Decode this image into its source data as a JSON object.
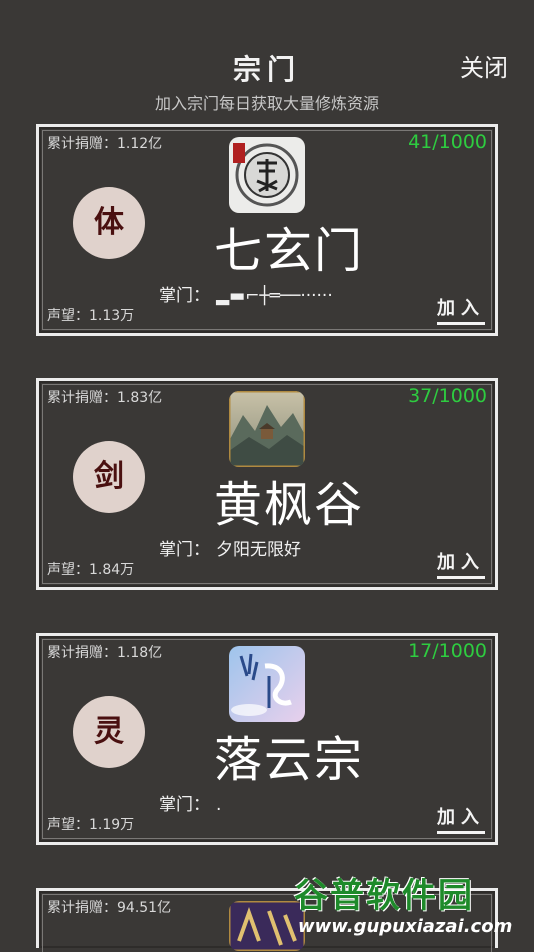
{
  "header": {
    "title": "宗门",
    "subtitle": "加入宗门每日获取大量修炼资源",
    "close_label": "关闭"
  },
  "sects": [
    {
      "donation": "累计捐赠：1.12亿",
      "members": "41/1000",
      "badge": "体",
      "name": "七玄门",
      "leader_label": "掌门：",
      "leader": "▂▬⌐┼═──······",
      "reputation": "声望：1.13万",
      "join_label": "加入",
      "icon": "dragon-seal-icon"
    },
    {
      "donation": "累计捐赠：1.83亿",
      "members": "37/1000",
      "badge": "剑",
      "name": "黄枫谷",
      "leader_label": "掌门：",
      "leader": "夕阳无限好",
      "reputation": "声望：1.84万",
      "join_label": "加入",
      "icon": "mountain-temple-icon"
    },
    {
      "donation": "累计捐赠：1.18亿",
      "members": "17/1000",
      "badge": "灵",
      "name": "落云宗",
      "leader_label": "掌门：",
      "leader": ".",
      "reputation": "声望：1.19万",
      "join_label": "加入",
      "icon": "cloud-calligraphy-icon"
    },
    {
      "donation": "累计捐赠：94.51亿",
      "icon": "partial-sect-icon"
    }
  ],
  "watermark": {
    "brand": "谷普软件园",
    "url": "www.gupuxiazai.com"
  },
  "colors": {
    "background": "#3a3836",
    "member_count": "#2ecc40",
    "badge_bg": "#e0d2cc",
    "badge_text": "#4a1010"
  }
}
